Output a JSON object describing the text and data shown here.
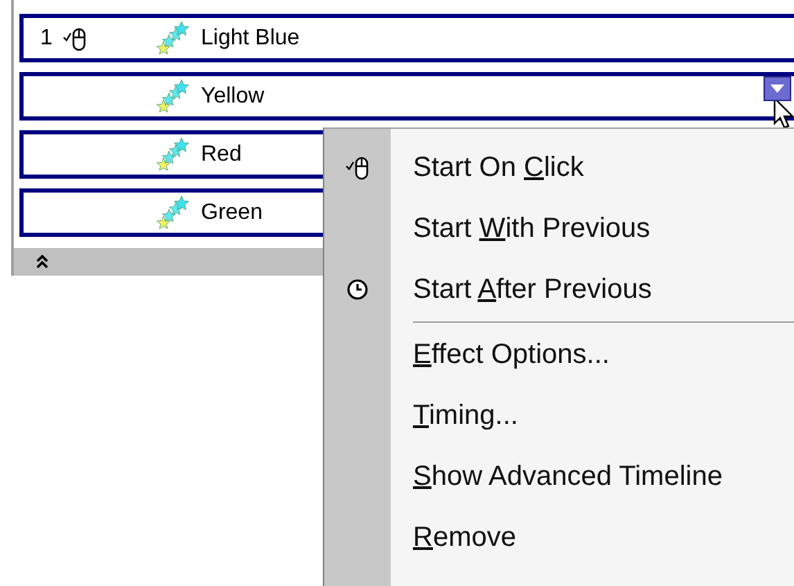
{
  "effects": [
    {
      "number": "1",
      "kind": "click",
      "label": "Light Blue",
      "selected": false
    },
    {
      "kind": "plain",
      "label": "Yellow",
      "selected": true
    },
    {
      "kind": "plain",
      "label": "Red",
      "selected": false
    },
    {
      "kind": "plain",
      "label": "Green",
      "selected": false
    }
  ],
  "context_menu": [
    {
      "kind": "mouse",
      "before": "Start On ",
      "key": "C",
      "after": "lick"
    },
    {
      "kind": "plain",
      "before": "Start ",
      "key": "W",
      "after": "ith Previous"
    },
    {
      "kind": "clock",
      "before": "Start ",
      "key": "A",
      "after": "fter Previous"
    },
    {
      "kind": "plain",
      "key": "E",
      "after": "ffect Options...",
      "separator_before": true
    },
    {
      "kind": "plain",
      "key": "T",
      "after": "iming..."
    },
    {
      "kind": "plain",
      "key": "S",
      "after": "how Advanced Timeline"
    },
    {
      "kind": "plain",
      "key": "R",
      "after": "emove"
    }
  ]
}
